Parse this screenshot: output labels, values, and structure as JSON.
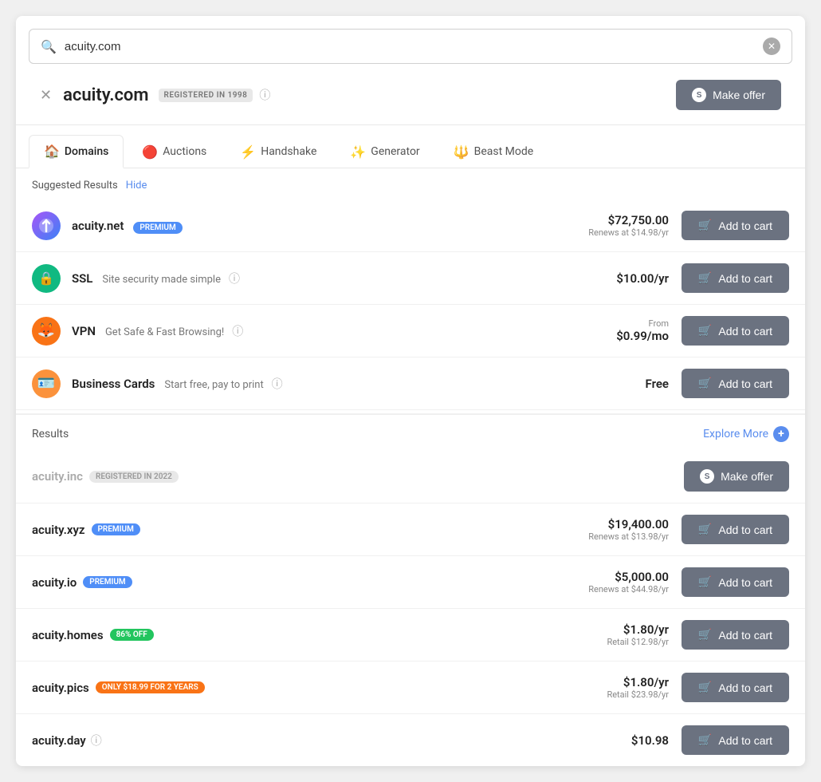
{
  "search": {
    "value": "acuity.com",
    "placeholder": "acuity.com",
    "clear_label": "✕"
  },
  "main_result": {
    "domain": "acuity.com",
    "badge": "REGISTERED IN 1998",
    "make_offer_label": "Make offer"
  },
  "tabs": [
    {
      "id": "domains",
      "label": "Domains",
      "icon": "🏠",
      "active": true
    },
    {
      "id": "auctions",
      "label": "Auctions",
      "icon": "🔴",
      "active": false
    },
    {
      "id": "handshake",
      "label": "Handshake",
      "icon": "⚡",
      "active": false
    },
    {
      "id": "generator",
      "label": "Generator",
      "icon": "✨",
      "active": false
    },
    {
      "id": "beastmode",
      "label": "Beast Mode",
      "icon": "🔱",
      "active": false
    }
  ],
  "suggested": {
    "label": "Suggested Results",
    "hide_label": "Hide",
    "items": [
      {
        "id": "acuity-net",
        "name": "acuity.net",
        "badge_type": "premium",
        "badge_label": "PREMIUM",
        "price_main": "$72,750.00",
        "price_sub": "Renews at $14.98/yr",
        "button_label": "Add to cart"
      },
      {
        "id": "ssl",
        "name": "SSL",
        "desc": "Site security made simple",
        "has_info": true,
        "price_main": "$10.00/yr",
        "button_label": "Add to cart"
      },
      {
        "id": "vpn",
        "name": "VPN",
        "desc": "Get Safe & Fast Browsing!",
        "has_info": true,
        "price_from": "From",
        "price_main": "$0.99/mo",
        "button_label": "Add to cart"
      },
      {
        "id": "business-cards",
        "name": "Business Cards",
        "desc": "Start free, pay to print",
        "has_info": true,
        "price_main": "Free",
        "button_label": "Add to cart"
      }
    ]
  },
  "results": {
    "label": "Results",
    "explore_more_label": "Explore More",
    "items": [
      {
        "id": "acuity-inc",
        "name": "acuity.inc",
        "unavailable": true,
        "badge_type": "registered",
        "badge_label": "REGISTERED IN 2022",
        "button_label": "Make offer",
        "is_make_offer": true
      },
      {
        "id": "acuity-xyz",
        "name": "acuity.xyz",
        "badge_type": "premium",
        "badge_label": "PREMIUM",
        "price_main": "$19,400.00",
        "price_sub": "Renews at $13.98/yr",
        "button_label": "Add to cart"
      },
      {
        "id": "acuity-io",
        "name": "acuity.io",
        "badge_type": "premium",
        "badge_label": "PREMIUM",
        "price_main": "$5,000.00",
        "price_sub": "Renews at $44.98/yr",
        "button_label": "Add to cart"
      },
      {
        "id": "acuity-homes",
        "name": "acuity.homes",
        "badge_type": "off",
        "badge_label": "86% OFF",
        "price_main": "$1.80/yr",
        "price_sub": "Retail $12.98/yr",
        "button_label": "Add to cart"
      },
      {
        "id": "acuity-pics",
        "name": "acuity.pics",
        "badge_type": "deal",
        "badge_label": "ONLY $18.99 FOR 2 YEARS",
        "price_main": "$1.80/yr",
        "price_sub": "Retail $23.98/yr",
        "button_label": "Add to cart"
      },
      {
        "id": "acuity-day",
        "name": "acuity.day",
        "has_info": true,
        "price_main": "$10.98",
        "button_label": "Add to cart"
      }
    ]
  },
  "icons": {
    "search": "🔍",
    "cart": "🛒",
    "sedo": "S"
  }
}
